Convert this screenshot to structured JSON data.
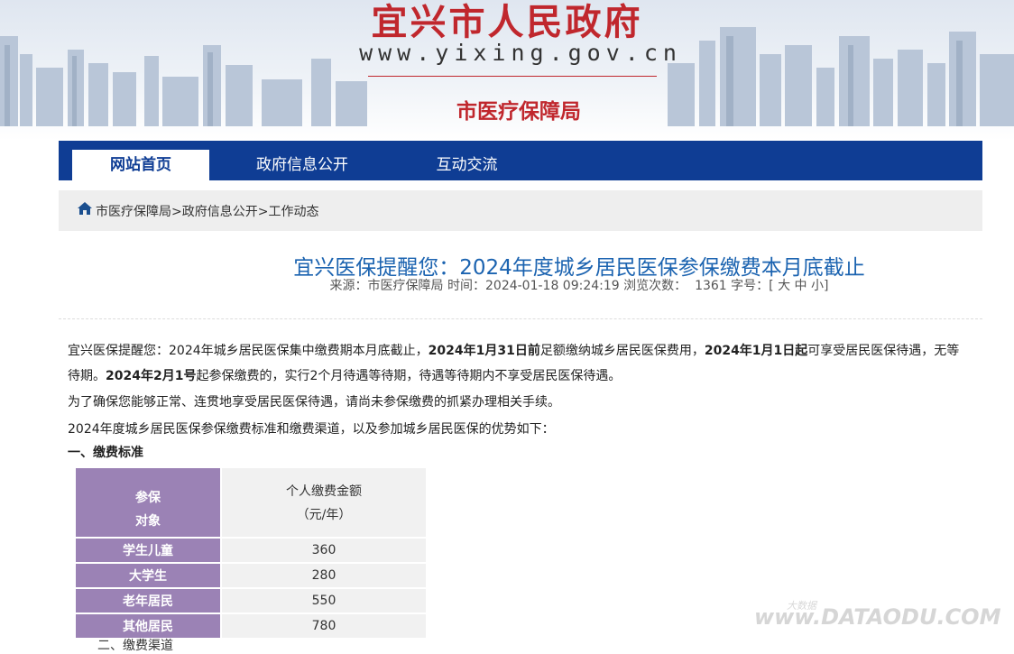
{
  "header": {
    "site_title": "宜兴市人民政府",
    "site_url": "www.yixing.gov.cn",
    "department": "市医疗保障局"
  },
  "nav": {
    "items": [
      {
        "label": "网站首页",
        "active": true
      },
      {
        "label": "政府信息公开",
        "active": false
      },
      {
        "label": "互动交流",
        "active": false
      }
    ]
  },
  "breadcrumb": {
    "text": "市医疗保障局>政府信息公开>工作动态"
  },
  "article": {
    "title": "宜兴医保提醒您：2024年度城乡居民医保参保缴费本月底截止",
    "meta": {
      "source_label": "来源：",
      "source": "市医疗保障局",
      "time_label": "时间：",
      "time": "2024-01-18 09:24:19",
      "views_label": "浏览次数：",
      "views": "1361",
      "font_label": "字号：",
      "font_open": "[",
      "font_large": "大",
      "font_medium": "中",
      "font_small": "小",
      "font_close": "]"
    },
    "p1_a": "宜兴医保提醒您：2024年城乡居民医保集中缴费期本月底截止，",
    "p1_b": "2024年1月31日前",
    "p1_c": "足额缴纳城乡居民医保费用，",
    "p1_d": "2024年1月1日起",
    "p1_e": "可享受居民医保待遇，无等待期。",
    "p1_f": "2024年2月1号",
    "p1_g": "起参保缴费的，实行2个月待遇等待期，待遇等待期内不享受居民医保待遇。",
    "p2": "为了确保您能够正常、连贯地享受居民医保待遇，请尚未参保缴费的抓紧办理相关手续。",
    "p3": "2024年度城乡居民医保参保缴费标准和缴费渠道，以及参加城乡居民医保的优势如下：",
    "section1": "一、缴费标准",
    "next_section_partial": "二、缴费渠道"
  },
  "fee_table": {
    "header_left_line1": "参保",
    "header_left_line2": "对象",
    "header_right_line1": "个人缴费金额",
    "header_right_line2": "（元/年）",
    "rows": [
      {
        "label": "学生儿童",
        "value": "360"
      },
      {
        "label": "大学生",
        "value": "280"
      },
      {
        "label": "老年居民",
        "value": "550"
      },
      {
        "label": "其他居民",
        "value": "780"
      }
    ]
  },
  "watermark": {
    "text": "www.DATAODU.COM",
    "small": "大数据"
  },
  "colors": {
    "brand_red": "#c0272d",
    "nav_blue": "#0f3d94",
    "title_blue": "#1b63b0",
    "table_purple": "#9b82b5"
  }
}
